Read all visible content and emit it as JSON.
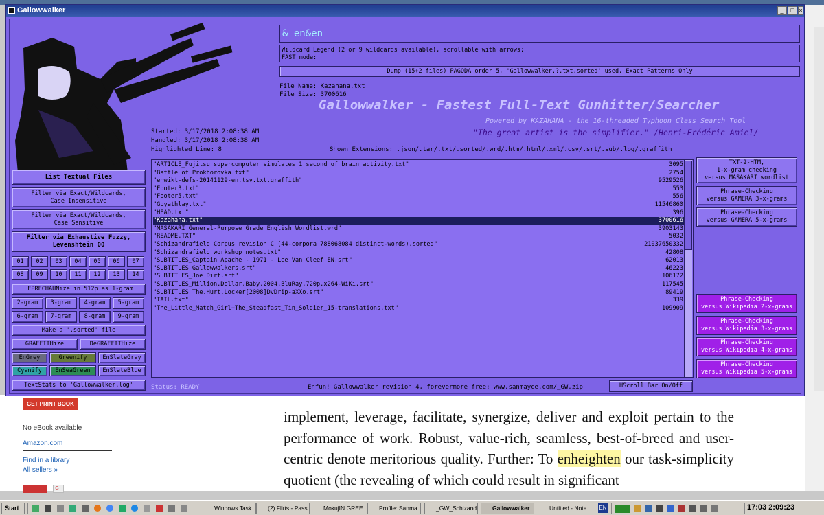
{
  "window": {
    "title": "Gallowwalker"
  },
  "search": {
    "value": "& en&en"
  },
  "wildcard_legend": {
    "line1": "Wildcard Legend (2 or 9 wildcards available), scrollable with arrows:",
    "line2": "FAST mode:"
  },
  "dump_button": "Dump (15+2 files) PAGODA order 5, 'Gallowwalker.?.txt.sorted' used, Exact Patterns Only",
  "file_info": {
    "name": "File Name: Kazahana.txt",
    "size": "File Size: 3700616"
  },
  "banner": {
    "title": "Gallowwalker - Fastest Full-Text Gunhitter/Searcher",
    "powered": "Powered by KAZAHANA - the 16-threaded Typhoon Class Search Tool",
    "quote": "\"The great artist is the simplifier.\" /Henri-Frédéric Amiel/"
  },
  "stats": {
    "started": "Started: 3/17/2018 2:08:38 AM",
    "handled": "Handled: 3/17/2018 2:08:38 AM",
    "highlighted": "Highlighted Line: 8",
    "extensions": "Shown Extensions: .json/.tar/.txt/.sorted/.wrd/.htm/.html/.xml/.csv/.srt/.sub/.log/.graffith"
  },
  "files": [
    {
      "name": "\"ARTICLE_Fujitsu supercomputer simulates 1 second of brain activity.txt\"",
      "size": "3095"
    },
    {
      "name": "\"Battle of Prokhorovka.txt\"",
      "size": "2754"
    },
    {
      "name": "\"enwikt-defs-20141129-en.tsv.txt.graffith\"",
      "size": "9529526"
    },
    {
      "name": "\"Footer3.txt\"",
      "size": "553"
    },
    {
      "name": "\"Footer5.txt\"",
      "size": "556"
    },
    {
      "name": "\"Goyathlay.txt\"",
      "size": "11546860"
    },
    {
      "name": "\"HEAD.txt\"",
      "size": "396"
    },
    {
      "name": "\"Kazahana.txt\"",
      "size": "3700616"
    },
    {
      "name": "\"MASAKARI_General-Purpose_Grade_English_Wordlist.wrd\"",
      "size": "3903143"
    },
    {
      "name": "\"README.TXT\"",
      "size": "5032"
    },
    {
      "name": "\"Schizandrafield_Corpus_revision_C_(44-corpora_788068084_distinct-words).sorted\"",
      "size": "21037650332"
    },
    {
      "name": "\"Schizandrafield_workshop_notes.txt\"",
      "size": "42808"
    },
    {
      "name": "\"SUBTITLES_Captain Apache - 1971 - Lee Van Cleef EN.srt\"",
      "size": "62013"
    },
    {
      "name": "\"SUBTITLES_Gallowwalkers.srt\"",
      "size": "46223"
    },
    {
      "name": "\"SUBTITLES_Joe Dirt.srt\"",
      "size": "106172"
    },
    {
      "name": "\"SUBTITLES_Million.Dollar.Baby.2004.BluRay.720p.x264-WiKi.srt\"",
      "size": "117545"
    },
    {
      "name": "\"SUBTITLES_The.Hurt.Locker[2008]DvDrip-aXXo.srt\"",
      "size": "89419"
    },
    {
      "name": "\"TAIL.txt\"",
      "size": "339"
    },
    {
      "name": "\"The_Little_Match_Girl+The_Steadfast_Tin_Soldier_15-translations.txt\"",
      "size": "109909"
    }
  ],
  "left_buttons": {
    "list": "List Textual Files",
    "filter_ci": [
      "Filter via Exact/Wildcards,",
      "Case Insensitive"
    ],
    "filter_cs": [
      "Filter via Exact/Wildcards,",
      "Case Sensitive"
    ],
    "filter_fuzzy": [
      "Filter via Exhaustive Fuzzy,",
      "Levenshtein 00"
    ],
    "numbers": [
      "01",
      "02",
      "03",
      "04",
      "05",
      "06",
      "07",
      "08",
      "09",
      "10",
      "11",
      "12",
      "13",
      "14"
    ],
    "leprechaun": "LEPRECHAUNize in 512p as 1-gram",
    "grams": [
      "2-gram",
      "3-gram",
      "4-gram",
      "5-gram",
      "6-gram",
      "7-gram",
      "8-gram",
      "9-gram"
    ],
    "make_sorted": "Make a '.sorted' file",
    "graffith": "GRAFFITHize",
    "degraffith": "DeGRAFFITHize",
    "themes": [
      "EnGrey",
      "Greenify",
      "EnSlateGray",
      "Cyanify",
      "EnSeaGreen",
      "EnSlateBlue"
    ],
    "textstats": "TextStats to 'Gallowwalker.log'"
  },
  "right_buttons": {
    "txt2htm": [
      "TXT-2-HTM,",
      "1-x-gram checking",
      "versus MASAKARI wordlist"
    ],
    "phrase3": [
      "Phrase-Checking",
      "versus GAMERA 3-x-grams"
    ],
    "phrase5": [
      "Phrase-Checking",
      "versus GAMERA 5-x-grams"
    ],
    "wiki": [
      [
        "Phrase-Checking",
        "versus Wikipedia 2-x-grams"
      ],
      [
        "Phrase-Checking",
        "versus Wikipedia 3-x-grams"
      ],
      [
        "Phrase-Checking",
        "versus Wikipedia 4-x-grams"
      ],
      [
        "Phrase-Checking",
        "versus Wikipedia 5-x-grams"
      ]
    ]
  },
  "status": {
    "text": "Status: READY",
    "footer": "Enfun! Gallowwalker revision 4, forevermore free: www.sanmayce.com/_GW.zip",
    "hscroll": "HScroll Bar On/Off"
  },
  "background_page": {
    "print_book": "GET PRINT BOOK",
    "ebook": "No eBook available",
    "amazon": "Amazon.com",
    "library": "Find in a library",
    "sellers": "All sellers »",
    "para_before": "implement, leverage, facilitate, synergize, deliver and exploit pertain to the performance of work. Robust, value-rich, seamless, best-of-breed and user-centric denote meritorious quality. Further: To ",
    "para_highlight": "enheighten",
    "para_after": " our task-simplicity quotient (the revealing of which could result in significant"
  },
  "taskbar": {
    "start": "Start",
    "items": [
      "Windows Task ...",
      "(2) Flirts - Pass...",
      "MokujIN GREE...",
      "Profile: Sanma...",
      "_GW_Schizand...",
      "Gallowwalker",
      "Untitled - Note..."
    ],
    "lang": "EN",
    "clock": "17:03 2:09:23"
  },
  "colors": {
    "window_bg": "#7d63e6",
    "selected_row": "#1c1d5c",
    "magenta_button": "#a020e8",
    "banner_title": "#c8c0ff",
    "quote": "#3a0a8a"
  }
}
